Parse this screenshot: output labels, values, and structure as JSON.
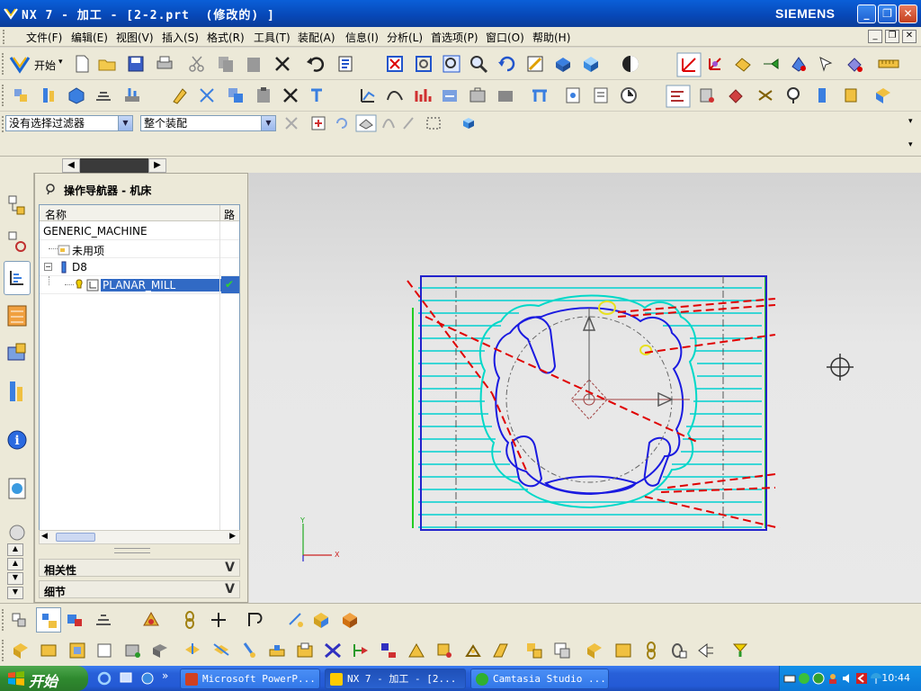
{
  "window": {
    "title": "NX 7 - 加工 - [2-2.prt  (修改的) ]",
    "brand": "SIEMENS"
  },
  "menu": [
    "文件(F)",
    "编辑(E)",
    "视图(V)",
    "插入(S)",
    "格式(R)",
    "工具(T)",
    "装配(A)",
    "信息(I)",
    "分析(L)",
    "首选项(P)",
    "窗口(O)",
    "帮助(H)"
  ],
  "toolbar": {
    "start_label": "开始",
    "start_arrow": "▾"
  },
  "filter": {
    "selection_filter": "没有选择过滤器",
    "assembly_scope": "整个装配"
  },
  "navigator": {
    "title": "操作导航器 - 机床",
    "columns": {
      "name": "名称",
      "path": "路"
    },
    "rows": [
      {
        "label": "GENERIC_MACHINE"
      },
      {
        "label": "未用项"
      },
      {
        "label": "D8"
      },
      {
        "label": "PLANAR_MILL",
        "check": "✔"
      }
    ],
    "sections": [
      "相关性",
      "细节"
    ],
    "section_toggle": "V"
  },
  "axis": {
    "x": "X",
    "y": "Y"
  },
  "taskbar": {
    "start_label": "开始",
    "buttons": [
      "Microsoft PowerP...",
      "NX 7 - 加工 - [2...",
      "Camtasia Studio ..."
    ],
    "clock": "10:44",
    "more": "»"
  },
  "colors": {
    "titlebar": "#0747b6",
    "taskbar": "#245ad6",
    "path": "#00d0d0",
    "part": "#1a1ae0",
    "rapid": "#e00000",
    "boundary": "#2222cc"
  }
}
